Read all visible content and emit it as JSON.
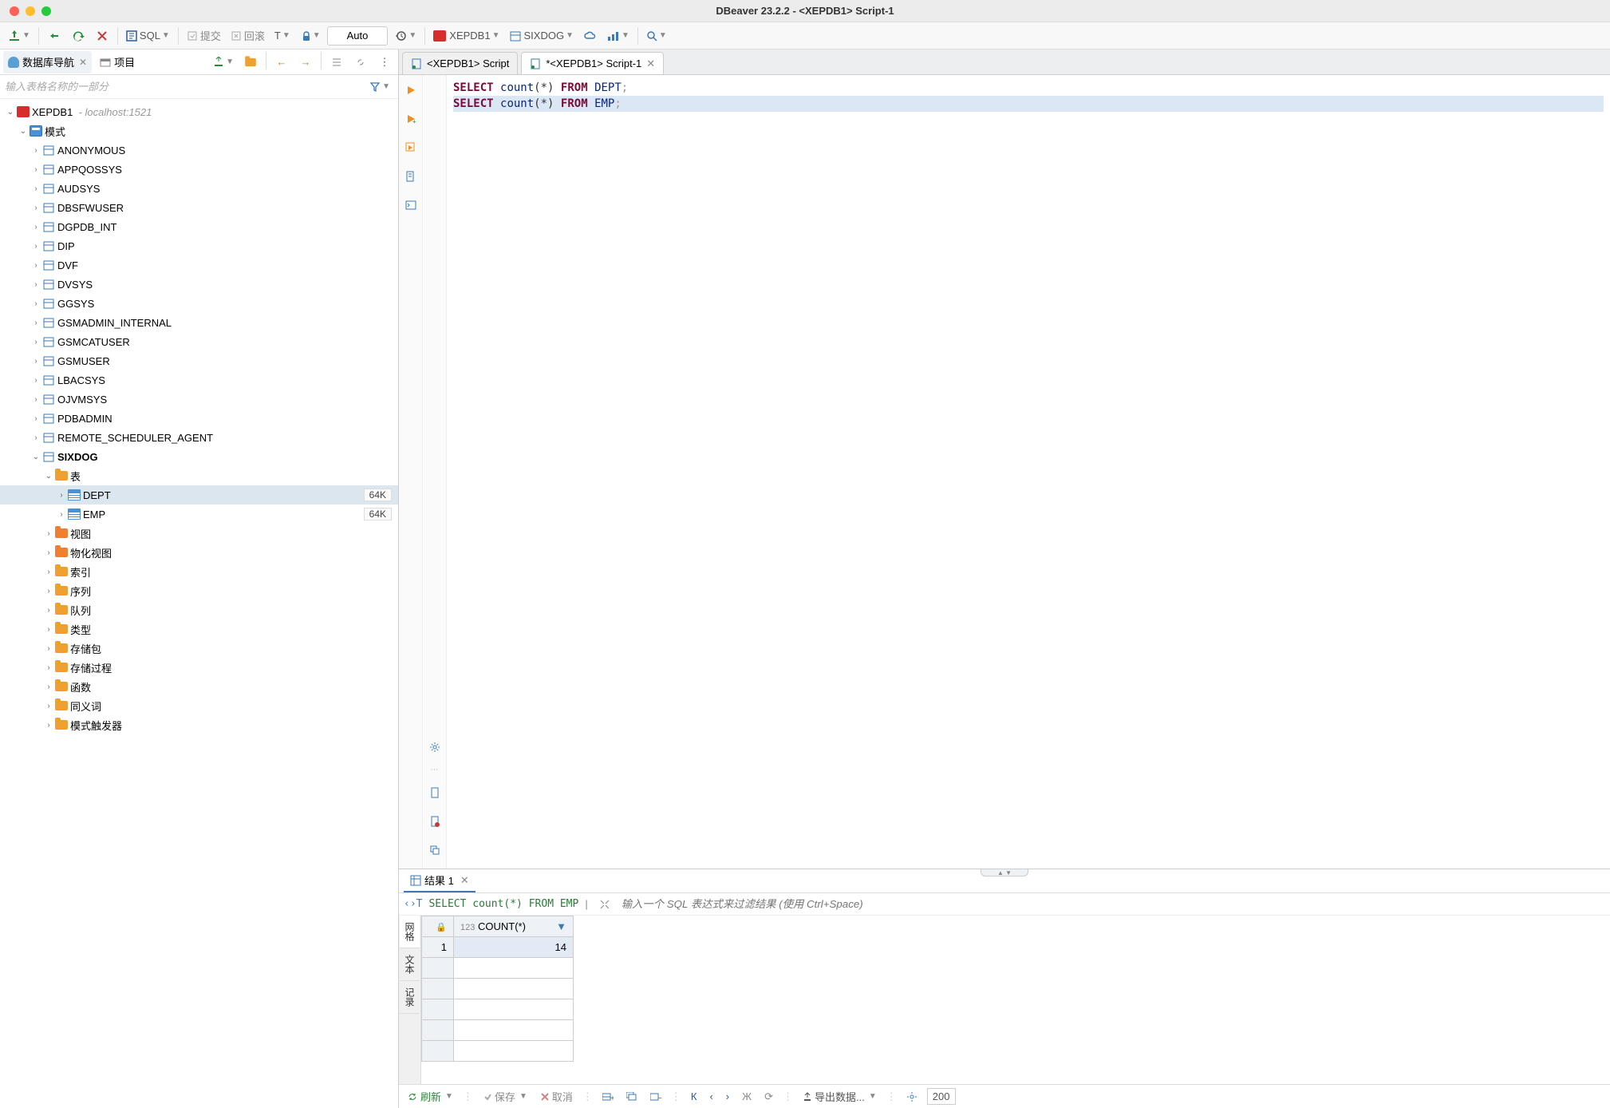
{
  "window": {
    "title": "DBeaver 23.2.2 - <XEPDB1> Script-1"
  },
  "toolbar": {
    "sql_label": "SQL",
    "commit_label": "提交",
    "rollback_label": "回滚",
    "auto_label": "Auto",
    "conn1": "XEPDB1",
    "conn2": "SIXDOG"
  },
  "sidebar": {
    "nav_tab": "数据库导航",
    "proj_tab": "项目",
    "filter_placeholder": "输入表格名称的一部分",
    "root": {
      "name": "XEPDB1",
      "host": "localhost:1521"
    },
    "schemas_label": "模式",
    "schemas": [
      "ANONYMOUS",
      "APPQOSSYS",
      "AUDSYS",
      "DBSFWUSER",
      "DGPDB_INT",
      "DIP",
      "DVF",
      "DVSYS",
      "GGSYS",
      "GSMADMIN_INTERNAL",
      "GSMCATUSER",
      "GSMUSER",
      "LBACSYS",
      "OJVMSYS",
      "PDBADMIN",
      "REMOTE_SCHEDULER_AGENT"
    ],
    "active_schema": "SIXDOG",
    "tables_label": "表",
    "tables": [
      {
        "name": "DEPT",
        "size": "64K"
      },
      {
        "name": "EMP",
        "size": "64K"
      }
    ],
    "folders": [
      "视图",
      "物化视图",
      "索引",
      "序列",
      "队列",
      "类型",
      "存储包",
      "存储过程",
      "函数",
      "同义词",
      "模式触发器"
    ]
  },
  "editor": {
    "tab1": "<XEPDB1> Script",
    "tab2": "*<XEPDB1> Script-1",
    "line1": {
      "kw1": "SELECT",
      "fn": "count",
      "kw2": "FROM",
      "tbl": "DEPT"
    },
    "line2": {
      "kw1": "SELECT",
      "fn": "count",
      "kw2": "FROM",
      "tbl": "EMP"
    }
  },
  "results": {
    "tab": "结果 1",
    "query": "SELECT count(*) FROM EMP",
    "filter_placeholder": "输入一个 SQL 表达式来过滤结果 (使用 Ctrl+Space)",
    "col_header": "COUNT(*)",
    "col_prefix": "123",
    "row_num": "1",
    "value": "14",
    "vtabs": [
      "网格",
      "文本",
      "记录"
    ],
    "footer": {
      "refresh": "刷新",
      "save": "保存",
      "cancel": "取消",
      "export": "导出数据...",
      "rows": "200"
    }
  }
}
